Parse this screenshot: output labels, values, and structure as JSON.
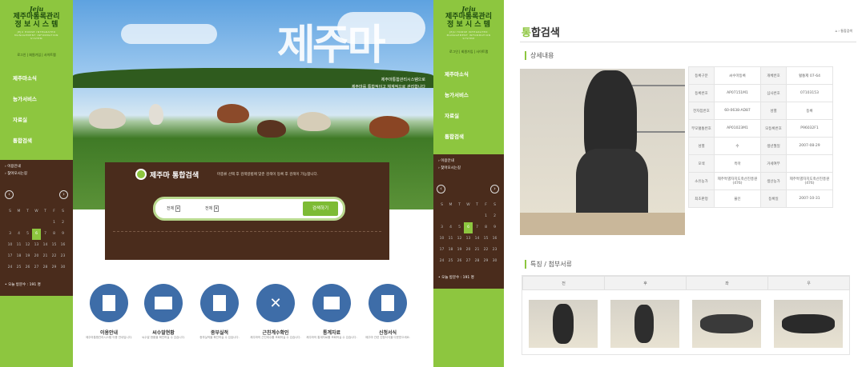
{
  "left_panel": {
    "logo": {
      "brand": "Jeju",
      "title_line1": "제주마통록관리",
      "title_line2": "정 보 시 스 템",
      "subtitle_en": "JEJU HORSE INTEGRATED MANAGEMENT INFORMATION SYSTEM"
    },
    "top_links": [
      "로그인",
      "회원가입",
      "사이트맵"
    ],
    "menu": [
      "제주마소식",
      "농가서비스",
      "자료실",
      "통합검색"
    ],
    "notice_items": [
      "이용안내",
      "찾아오시는길"
    ],
    "calendar": {
      "weekdays": [
        "S",
        "M",
        "T",
        "W",
        "T",
        "F",
        "S"
      ],
      "weeks": [
        [
          "",
          "",
          "",
          "",
          "",
          "1",
          "2"
        ],
        [
          "3",
          "4",
          "5",
          "6",
          "7",
          "8",
          "9"
        ],
        [
          "10",
          "11",
          "12",
          "13",
          "14",
          "15",
          "16"
        ],
        [
          "17",
          "18",
          "19",
          "20",
          "21",
          "22",
          "23"
        ],
        [
          "24",
          "25",
          "26",
          "27",
          "28",
          "29",
          "30"
        ]
      ],
      "today": "6"
    },
    "visitors": "오늘 방문수 : 191 명"
  },
  "hero": {
    "calligraphy": "제주마",
    "caption_line1": "제주마통합관리시스템으로",
    "caption_line2": "제주마를 통합적이고 체계적으로 관리합니다"
  },
  "search": {
    "title": "제주마 통합검색",
    "desc": "마종류 선택 후 검색방법에 맞춘 검색이 등록 후 검색이 가능합니다.",
    "select1": "전체",
    "select2": "전체",
    "button": "검색하기"
  },
  "services": [
    {
      "title": "이용안내",
      "desc": "제주마통합관리시스템 이용 안내입니다."
    },
    {
      "title": "씨수말현황",
      "desc": "씨수말 현황을 확인하실 수 있습니다."
    },
    {
      "title": "종부실적",
      "desc": "종부실적을 확인하실 수 있습니다."
    },
    {
      "title": "근친계수확인",
      "desc": "제주마의 근친계수를 조회하실 수 있습니다."
    },
    {
      "title": "통계자료",
      "desc": "제주마의 통계자료를 조회하실 수 있습니다."
    },
    {
      "title": "신청서식",
      "desc": "제주마 관련 신청서식을 다운받으세요."
    }
  ],
  "detail_page": {
    "title_highlight": "통",
    "title_rest": "합검색",
    "breadcrumb": "통합검색",
    "section1": "상세내용",
    "section2": "특징 / 첨부서류",
    "info_rows": [
      [
        "등록구분",
        "씨수마등록",
        "개체번호",
        "혈통제 07-64"
      ],
      [
        "등록번호",
        "AP07151M1",
        "심사번호",
        "07103153"
      ],
      [
        "전자칩번호",
        "60-0638-AD87",
        "성별",
        "등록"
      ],
      [
        "부모혈통번호",
        "AP01023M1",
        "모등록번호",
        "P96032F1"
      ],
      [
        "성별",
        "수",
        "생년월일",
        "2007-08-29"
      ],
      [
        "모색",
        "흑마",
        "거세여부",
        ""
      ],
      [
        "소유농가",
        "제주특별자치도축산진흥원(476)",
        "생산농가",
        "제주특별자치도축산진흥원(476)"
      ],
      [
        "최초판정",
        "불인",
        "등록일",
        "2007-10-31"
      ]
    ],
    "photo_labels": [
      "전",
      "후",
      "좌",
      "우"
    ]
  }
}
